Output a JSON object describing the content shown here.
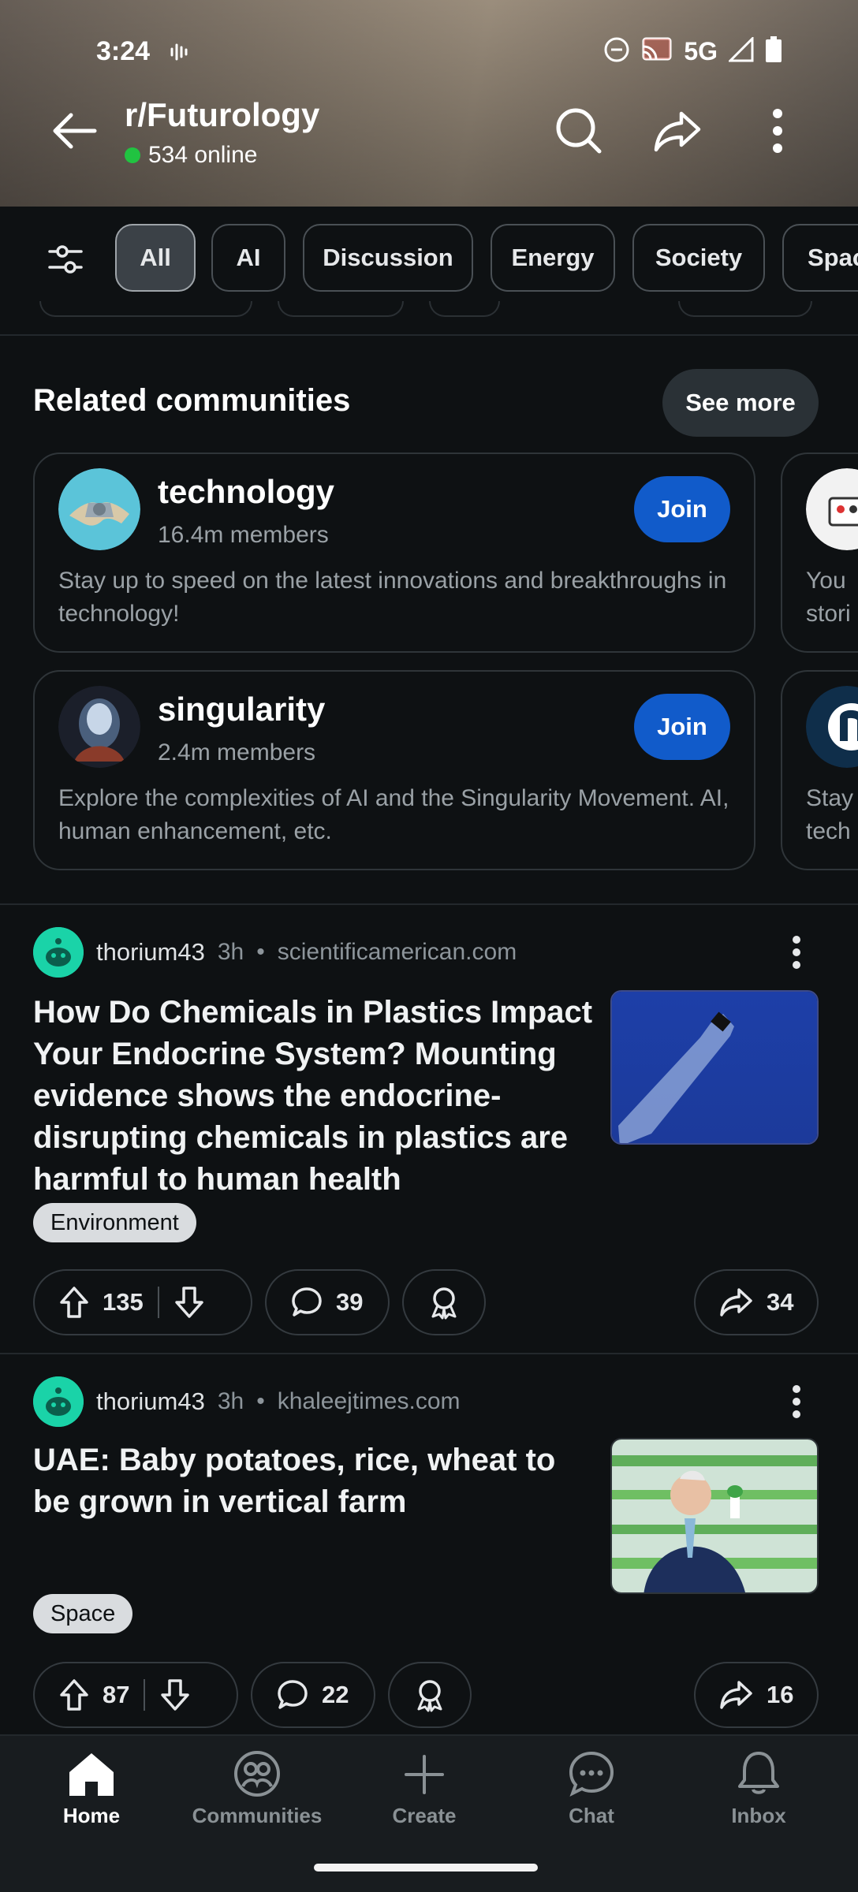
{
  "status_bar": {
    "time": "3:24",
    "network": "5G"
  },
  "header": {
    "subreddit": "r/Futurology",
    "online": "534 online"
  },
  "flairs": [
    "All",
    "AI",
    "Discussion",
    "Energy",
    "Society",
    "Spac"
  ],
  "related": {
    "title": "Related communities",
    "see_more": "See more",
    "communities": [
      {
        "name": "technology",
        "members": "16.4m members",
        "join": "Join",
        "desc": "Stay up to speed on the latest innovations and breakthroughs in technology!"
      },
      {
        "name": "singularity",
        "members": "2.4m members",
        "join": "Join",
        "desc": "Explore the complexities of AI and the Singularity Movement. AI, human enhancement, etc."
      }
    ],
    "peek": [
      {
        "line1": "You",
        "line2": "stori"
      },
      {
        "line1": "Stay",
        "line2": "tech"
      }
    ]
  },
  "posts": [
    {
      "user": "thorium43",
      "age": "3h",
      "domain": "scientificamerican.com",
      "title": "How Do Chemicals in Plastics Impact Your Endocrine System? Mounting evidence shows the endocrine-disrupting chemicals in plastics are harmful to human health",
      "flair": "Environment",
      "upvotes": "135",
      "comments": "39",
      "shares": "34"
    },
    {
      "user": "thorium43",
      "age": "3h",
      "domain": "khaleejtimes.com",
      "title": "UAE: Baby potatoes, rice, wheat to be grown in vertical farm",
      "flair": "Space",
      "upvotes": "87",
      "comments": "22",
      "shares": "16"
    }
  ],
  "bottom_nav": [
    {
      "label": "Home",
      "icon": "home-icon"
    },
    {
      "label": "Communities",
      "icon": "communities-icon"
    },
    {
      "label": "Create",
      "icon": "plus-icon"
    },
    {
      "label": "Chat",
      "icon": "chat-icon"
    },
    {
      "label": "Inbox",
      "icon": "bell-icon"
    }
  ],
  "colors": {
    "join": "#115bca",
    "online_dot": "#21c341",
    "background": "#0e1113"
  }
}
